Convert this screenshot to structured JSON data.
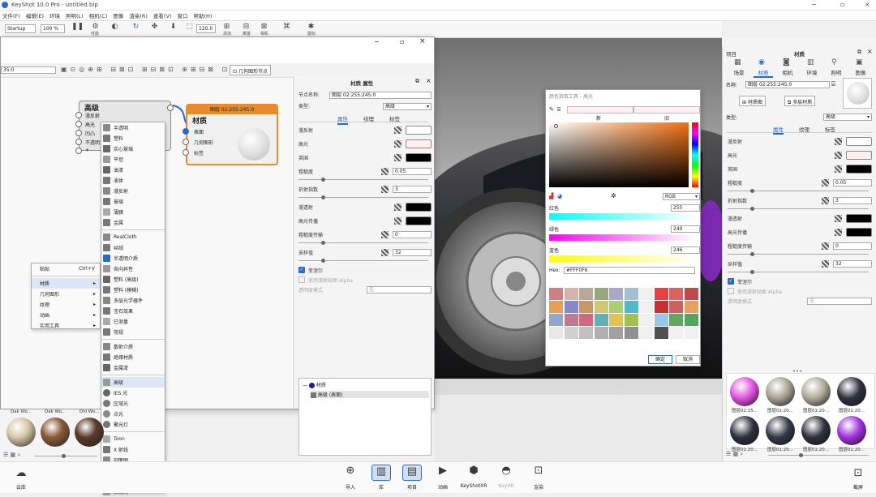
{
  "app": {
    "title": "KeyShot 10.0 Pro - untitled.bip"
  },
  "menu": [
    "文件(F)",
    "编辑(E)",
    "环境",
    "照明(L)",
    "相机(C)",
    "图像",
    "渲染(R)",
    "查看(V)",
    "窗口",
    "帮助(H)"
  ],
  "toolbar": {
    "workspace": "Startup",
    "zoom": "100 %",
    "fps": "120.0",
    "labels": [
      "性能",
      "",
      "",
      "",
      "",
      "",
      "",
      "",
      "",
      "添加",
      "乘置",
      "相机",
      "",
      "",
      "图标"
    ]
  },
  "material_graph": {
    "search_value": "35:0",
    "geometry_node_btn": "几何图形节点",
    "advanced_node": {
      "title": "高级",
      "ports": [
        "漫反射",
        "高光",
        "凹凸",
        "不透明",
        "+"
      ]
    },
    "material_node": {
      "header": "图层 02:255:245:0",
      "title": "材质",
      "ports": [
        "表面",
        "几何图形",
        "标签"
      ]
    }
  },
  "context_menu": {
    "items": [
      {
        "label": "粘贴",
        "shortcut": "Ctrl+V"
      },
      {
        "label": "材质",
        "arrow": "▸"
      },
      {
        "label": "几何图形",
        "arrow": "▸"
      },
      {
        "label": "纹理",
        "arrow": "▸"
      },
      {
        "label": "动画",
        "arrow": "▸"
      },
      {
        "label": "实用工具",
        "arrow": "▸"
      }
    ]
  },
  "submenu": {
    "items": [
      "半透明",
      "塑料",
      "实心玻璃",
      "平坦",
      "油漆",
      "液体",
      "漫反射",
      "玻璃",
      "薄膜",
      "金属",
      "RealCloth",
      "丝绒",
      "半透明介质",
      "各向异性",
      "塑料 (高级)",
      "塑料 (模糊)",
      "多层光学器件",
      "宝石效果",
      "已测量",
      "常规",
      "散射介质",
      "绝缘材质",
      "金属漆",
      "高级",
      "IES 光",
      "区域光",
      "点光",
      "聚光灯",
      "Toon",
      "X 射线",
      "剖面图",
      "地面",
      "线框",
      "自发光"
    ]
  },
  "props": {
    "header": "材质 属性",
    "node_name_label": "节点名称:",
    "node_name": "图层 02:255:245:0",
    "type_label": "类型:",
    "type": "高级",
    "tabs": [
      "属性",
      "纹理",
      "标签"
    ],
    "rows": [
      {
        "label": "漫反射",
        "color": "#ffffff"
      },
      {
        "label": "高光",
        "color": "#fff0ee"
      },
      {
        "label": "英国",
        "color": "#000000"
      }
    ],
    "roughness_label": "粗糙度",
    "roughness": "0.05",
    "ior_label": "折射指数",
    "ior": "3",
    "rows2": [
      {
        "label": "漫透射",
        "color": "#000000"
      },
      {
        "label": "高光传播",
        "color": "#000000"
      }
    ],
    "rough_trans_label": "粗糙度传输",
    "rough_trans": "0",
    "samples_label": "采样值",
    "samples": "32",
    "fresnel": "菲涅尔",
    "alpha": "使用漫射贴图 Alpha",
    "transparency_mode": "透明度模式",
    "transparency_value": "无",
    "tree": {
      "root": "材质",
      "child": "高级 (表面)"
    }
  },
  "color_picker": {
    "title": "颜色拾取工具 - 高光",
    "new": "新",
    "old": "旧",
    "mode": "RGB",
    "red_label": "红色",
    "red": "255",
    "green_label": "绿色",
    "green": "240",
    "blue_label": "蓝色",
    "blue": "246",
    "hex_label": "Hex:",
    "hex": "#FFF0F6",
    "ok": "确定",
    "cancel": "取消",
    "swatches": [
      "#d08080",
      "#d4b4a8",
      "#b8a898",
      "#98a878",
      "#a8a8c8",
      "#a0c0d0",
      "#f0f0f0",
      "#e84040",
      "#e06060",
      "#c04848",
      "#e8a050",
      "#8888c8",
      "#c89868",
      "#d0c870",
      "#a8d070",
      "#50b8c8",
      "#f0f0f0",
      "#c83030",
      "#d06060",
      "#e8a060",
      "#90a8d0",
      "#c07890",
      "#d06880",
      "#60b0b8",
      "#e8c050",
      "#a0c050",
      "#f0f0f0",
      "#98c8e8",
      "#60a860",
      "#50a860",
      "#e8e8e8",
      "#d0d0d0",
      "#c0c0c0",
      "#b0b0b0",
      "#a0a0a0",
      "#909090",
      "#f0f0f0",
      "#505050",
      "#f0f0f0",
      "#f0f0f0"
    ]
  },
  "right_panel": {
    "project": "项目",
    "title": "材质",
    "tabs": [
      "场景",
      "材质",
      "相机",
      "环境",
      "照明",
      "图像"
    ],
    "name_label": "名称:",
    "name": "图层 02:255:245:0",
    "graph_btn": "材质图",
    "multi_btn": "多层材质",
    "type_label": "类型:",
    "type": "高级",
    "sub_tabs": [
      "属性",
      "纹理",
      "标签"
    ],
    "rows": [
      {
        "label": "漫反射",
        "color": "#ffffff"
      },
      {
        "label": "高光",
        "color": "#fff0ee"
      },
      {
        "label": "英国",
        "color": "#000000"
      }
    ],
    "roughness_label": "粗糙度",
    "roughness": "0.05",
    "ior_label": "折射指数",
    "ior": "3",
    "rows2": [
      {
        "label": "漫透射",
        "color": "#000000"
      },
      {
        "label": "高光传播",
        "color": "#000000"
      }
    ],
    "rough_trans_label": "粗糙度传输",
    "rough_trans": "0",
    "samples_label": "采样值",
    "samples": "32",
    "fresnel": "菲涅尔",
    "alpha": "使用漫射贴图 Alpha",
    "transparency_mode": "透明度模式",
    "transparency_value": "无",
    "balls": [
      {
        "label": "图层02:25...",
        "color": "#e050e0"
      },
      {
        "label": "图层01:20...",
        "color": "#a8a090"
      },
      {
        "label": "图层01:20...",
        "color": "#b0a898"
      },
      {
        "label": "图层01:20...",
        "color": "#303040"
      },
      {
        "label": "图层01:20...",
        "color": "#303040"
      },
      {
        "label": "图层01:20...",
        "color": "#383848"
      },
      {
        "label": "图层01:20...",
        "color": "#303040"
      },
      {
        "label": "图层01:20...",
        "color": "#a030e0"
      }
    ]
  },
  "library": {
    "items": [
      "Oak Wo...",
      "Oak Wo...",
      "Old Wo..."
    ]
  },
  "bottom": {
    "cloud": "云库",
    "items": [
      "导入",
      "库",
      "项目",
      "动画",
      "KeyShotXR",
      "KeyVR",
      "渲染"
    ],
    "right": "截屏"
  }
}
